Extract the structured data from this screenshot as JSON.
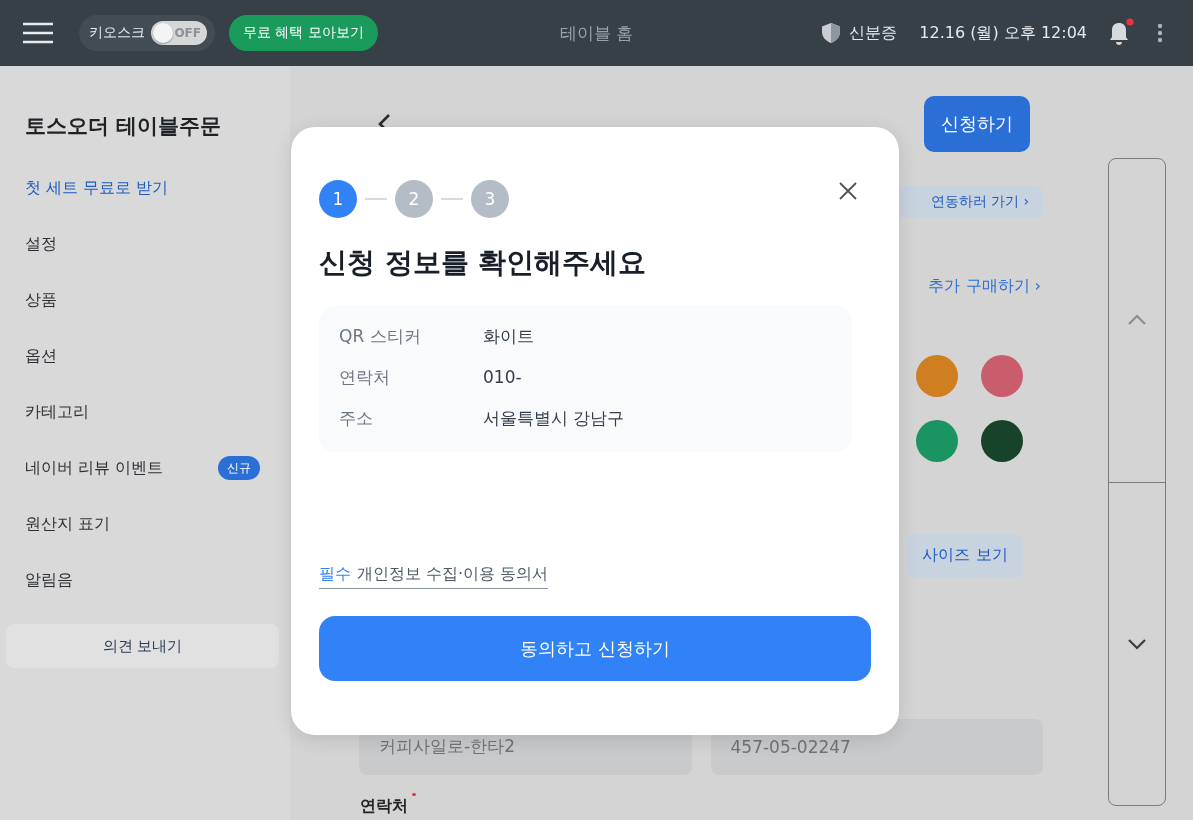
{
  "topbar": {
    "kiosk": {
      "label": "키오스크",
      "toggle_text": "OFF",
      "on": false
    },
    "promo_button": "무료 혜택 모아보기",
    "title": "테이블 홈",
    "id_card": "신분증",
    "datetime": "12.16 (월) 오후 12:04",
    "notification": {
      "unread": true
    }
  },
  "sidebar": {
    "title": "토스오더 테이블주문",
    "items": [
      {
        "label": "첫 세트 무료로 받기",
        "selected": true
      },
      {
        "label": "설정",
        "selected": false
      },
      {
        "label": "상품",
        "selected": false
      },
      {
        "label": "옵션",
        "selected": false
      },
      {
        "label": "카테고리",
        "selected": false
      },
      {
        "label": "네이버 리뷰 이벤트",
        "selected": false,
        "badge": "신규"
      },
      {
        "label": "원산지 표기",
        "selected": false
      },
      {
        "label": "알림음",
        "selected": false
      }
    ],
    "feedback_button": "의견 보내기"
  },
  "page": {
    "apply_button": "신청하기",
    "banner_link": "연동하러 가기 ›",
    "buy_more_link": "추가 구매하기 ›",
    "swatches": [
      {
        "color": "#cf7f20"
      },
      {
        "color": "#c95d6c"
      },
      {
        "color": "#1a9462"
      },
      {
        "color": "#17432b"
      }
    ],
    "size_button": "사이즈 보기",
    "fields": [
      {
        "value": "커피사일로-한타2"
      },
      {
        "value": "457-05-02247"
      }
    ],
    "contact_label": {
      "text": "연락처",
      "required": true
    }
  },
  "modal": {
    "steps": [
      {
        "number": "1",
        "selected": true
      },
      {
        "number": "2",
        "selected": false
      },
      {
        "number": "3",
        "selected": false
      }
    ],
    "title": "신청 정보를 확인해주세요",
    "summary": [
      {
        "label": "QR 스티커",
        "value": "화이트"
      },
      {
        "label": "연락처",
        "value": "010-"
      },
      {
        "label": "주소",
        "value": "서울특별시 강남구"
      }
    ],
    "agreement": {
      "tag": "필수",
      "text": "개인정보 수집·이용 동의서"
    },
    "submit_button": "동의하고 신청하기"
  }
}
